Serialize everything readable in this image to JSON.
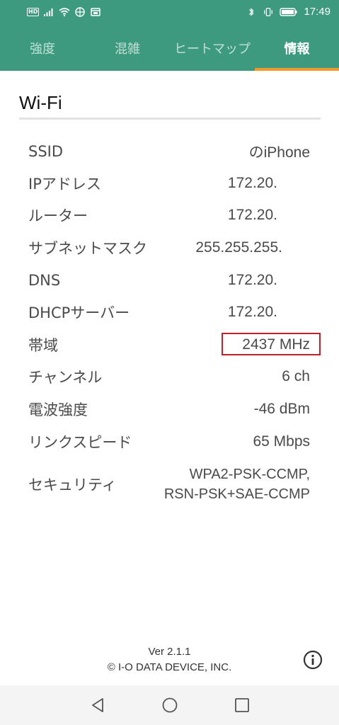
{
  "status_bar": {
    "hd_label": "HD",
    "time": "17:49"
  },
  "tabs": [
    {
      "label": "強度"
    },
    {
      "label": "混雑"
    },
    {
      "label": "ヒートマップ"
    },
    {
      "label": "情報",
      "active": true
    }
  ],
  "section": {
    "title": "Wi-Fi"
  },
  "info_rows": [
    {
      "label": "SSID",
      "value": "のiPhone"
    },
    {
      "label": "IPアドレス",
      "value": "172.20."
    },
    {
      "label": "ルーター",
      "value": "172.20."
    },
    {
      "label": "サブネットマスク",
      "value": "255.255.255."
    },
    {
      "label": "DNS",
      "value": "172.20."
    },
    {
      "label": "DHCPサーバー",
      "value": "172.20."
    },
    {
      "label": "帯域",
      "value": "2437 MHz",
      "highlighted": true
    },
    {
      "label": "チャンネル",
      "value": "6 ch"
    },
    {
      "label": "電波強度",
      "value": "-46 dBm"
    },
    {
      "label": "リンクスピード",
      "value": "65 Mbps"
    },
    {
      "label": "セキュリティ",
      "value": "WPA2-PSK-CCMP,\nRSN-PSK+SAE-CCMP"
    }
  ],
  "footer": {
    "version": "Ver 2.1.1",
    "copyright": "© I-O DATA DEVICE, INC."
  },
  "colors": {
    "primary": "#3d9a7e",
    "tab_indicator": "#ee9a2a",
    "highlight_border": "#c0202a"
  },
  "icons": [
    "signal-icon",
    "wifi-icon",
    "vpn-icon",
    "notification-icon",
    "bluetooth-icon",
    "vibrate-icon",
    "battery-icon",
    "info-icon",
    "back-icon",
    "home-icon",
    "recents-icon"
  ]
}
